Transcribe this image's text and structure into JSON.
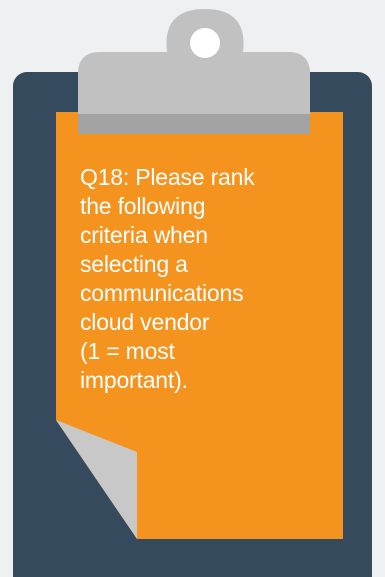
{
  "question_text": "Q18: Please rank\nthe following\ncriteria when\nselecting a\ncommunications\ncloud vendor\n(1 = most\nimportant).",
  "colors": {
    "background": "#eef0f1",
    "clipboard_board": "#354a5c",
    "paper": "#f5931f",
    "clip": "#c1c1c1",
    "clip_base": "#a3a3a3",
    "page_fold": "#c8c8c8"
  },
  "icons": {
    "clip": "clipboard-clip-icon",
    "fold": "page-fold-icon"
  }
}
